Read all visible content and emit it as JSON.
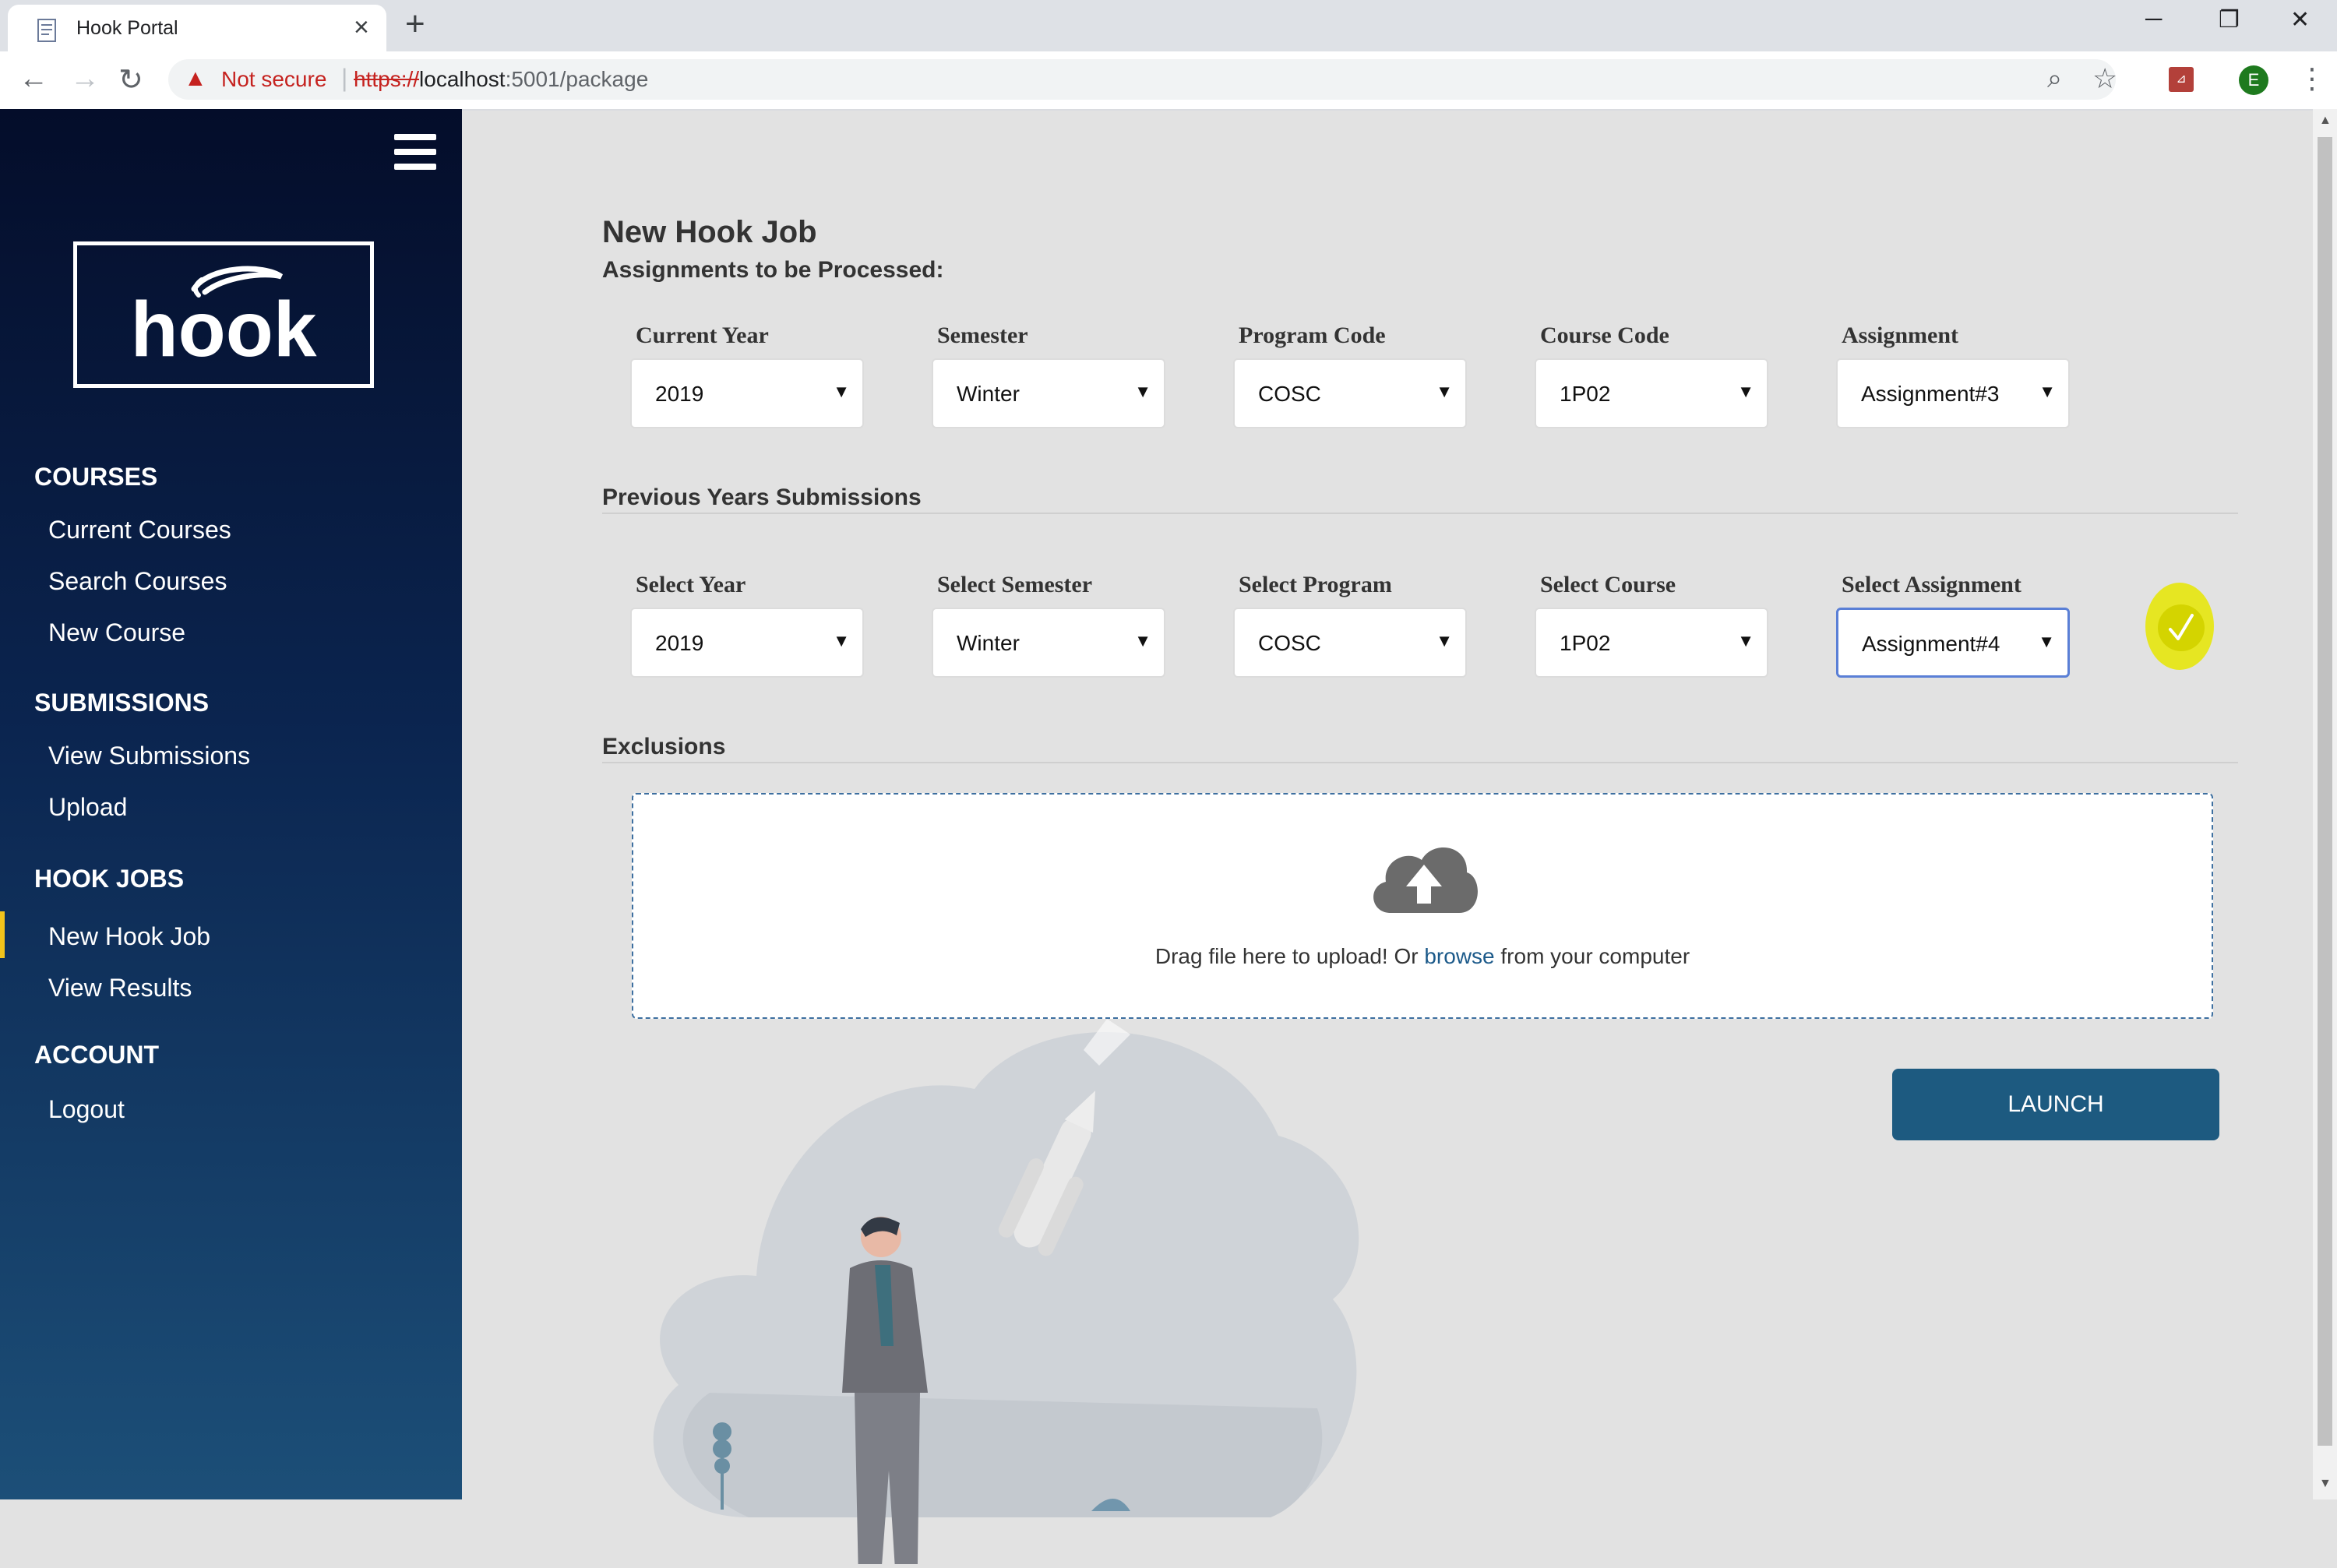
{
  "browser": {
    "tab_title": "Hook Portal",
    "new_tab": "+",
    "security": "Not secure",
    "url_scheme": "https://",
    "url_host": "localhost",
    "url_rest": ":5001/package",
    "profile_initial": "E"
  },
  "sidebar": {
    "logo_text": "hook",
    "sections": [
      {
        "heading": "COURSES",
        "items": [
          "Current Courses",
          "Search Courses",
          "New Course"
        ]
      },
      {
        "heading": "SUBMISSIONS",
        "items": [
          "View Submissions",
          "Upload"
        ]
      },
      {
        "heading": "HOOK JOBS",
        "items": [
          "New Hook Job",
          "View Results"
        ]
      },
      {
        "heading": "ACCOUNT",
        "items": [
          "Logout"
        ]
      }
    ],
    "active_item": "New Hook Job"
  },
  "main": {
    "title": "New Hook Job",
    "subtitle": "Assignments to be Processed:",
    "current": [
      {
        "label": "Current Year",
        "value": "2019"
      },
      {
        "label": "Semester",
        "value": "Winter"
      },
      {
        "label": "Program Code",
        "value": "COSC"
      },
      {
        "label": "Course Code",
        "value": "1P02"
      },
      {
        "label": "Assignment",
        "value": "Assignment#3"
      }
    ],
    "previous_heading": "Previous Years Submissions",
    "previous": [
      {
        "label": "Select Year",
        "value": "2019"
      },
      {
        "label": "Select Semester",
        "value": "Winter"
      },
      {
        "label": "Select Program",
        "value": "COSC"
      },
      {
        "label": "Select Course",
        "value": "1P02"
      },
      {
        "label": "Select Assignment",
        "value": "Assignment#4"
      }
    ],
    "exclusions_heading": "Exclusions",
    "dropzone": {
      "text_before": "Drag file here to upload! Or ",
      "link": "browse",
      "text_after": " from your computer"
    },
    "launch_label": "LAUNCH"
  },
  "colors": {
    "accent": "#1d5a80",
    "active_marker": "#f2c31b",
    "check_highlight": "#e6e600"
  }
}
